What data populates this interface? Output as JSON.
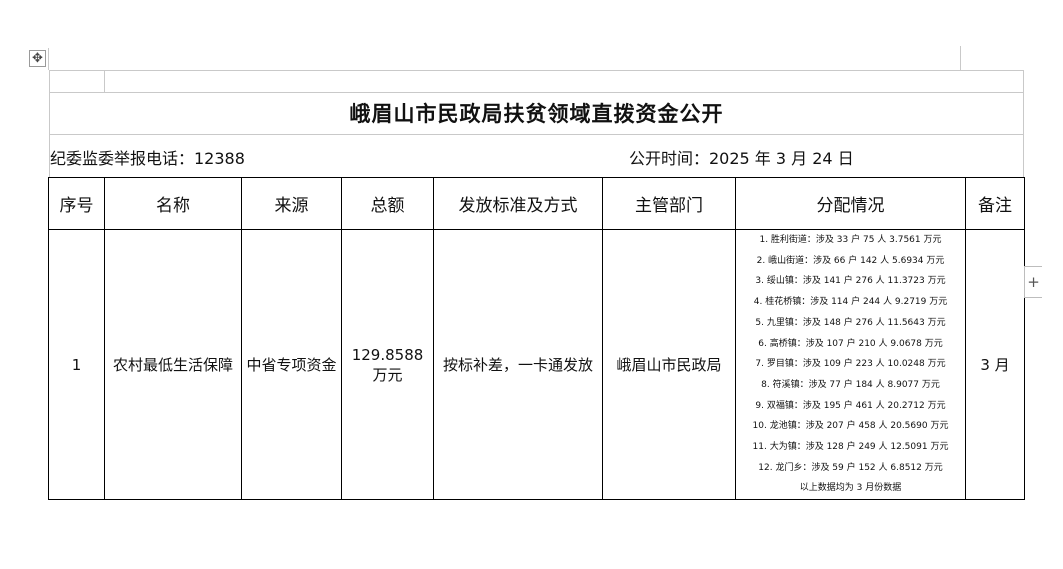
{
  "title": "峨眉山市民政局扶贫领域直拨资金公开",
  "report_phone": "纪委监委举报电话：12388",
  "publish_time": "公开时间：2025 年 3 月 24 日",
  "table": {
    "headers": [
      "序号",
      "名称",
      "来源",
      "总额",
      "发放标准及方式",
      "主管部门",
      "分配情况",
      "备注"
    ],
    "row": {
      "index": "1",
      "name": "农村最低生活保障",
      "source": "中省专项资金",
      "total": "129.8588 万元",
      "method": "按标补差，一卡通发放",
      "department": "峨眉山市民政局",
      "note": "3 月"
    },
    "distribution": [
      "1. 胜利街道：涉及 33 户 75 人 3.7561 万元",
      "2. 峨山街道：涉及 66 户 142 人 5.6934 万元",
      "3. 绥山镇：涉及 141 户 276 人 11.3723 万元",
      "4. 桂花桥镇：涉及 114 户 244 人 9.2719 万元",
      "5. 九里镇：涉及 148 户 276 人 11.5643 万元",
      "6. 高桥镇：涉及 107 户 210 人 9.0678 万元",
      "7. 罗目镇：涉及 109 户 223 人 10.0248 万元",
      "8. 符溪镇：涉及 77 户 184 人 8.9077 万元",
      "9. 双福镇：涉及 195 户 461 人 20.2712 万元",
      "10. 龙池镇：涉及 207 户 458 人 20.5690 万元",
      "11. 大为镇：涉及 128 户 249 人 12.5091 万元",
      "12. 龙门乡：涉及 59 户 152 人 6.8512 万元",
      "以上数据均为 3 月份数据"
    ]
  }
}
